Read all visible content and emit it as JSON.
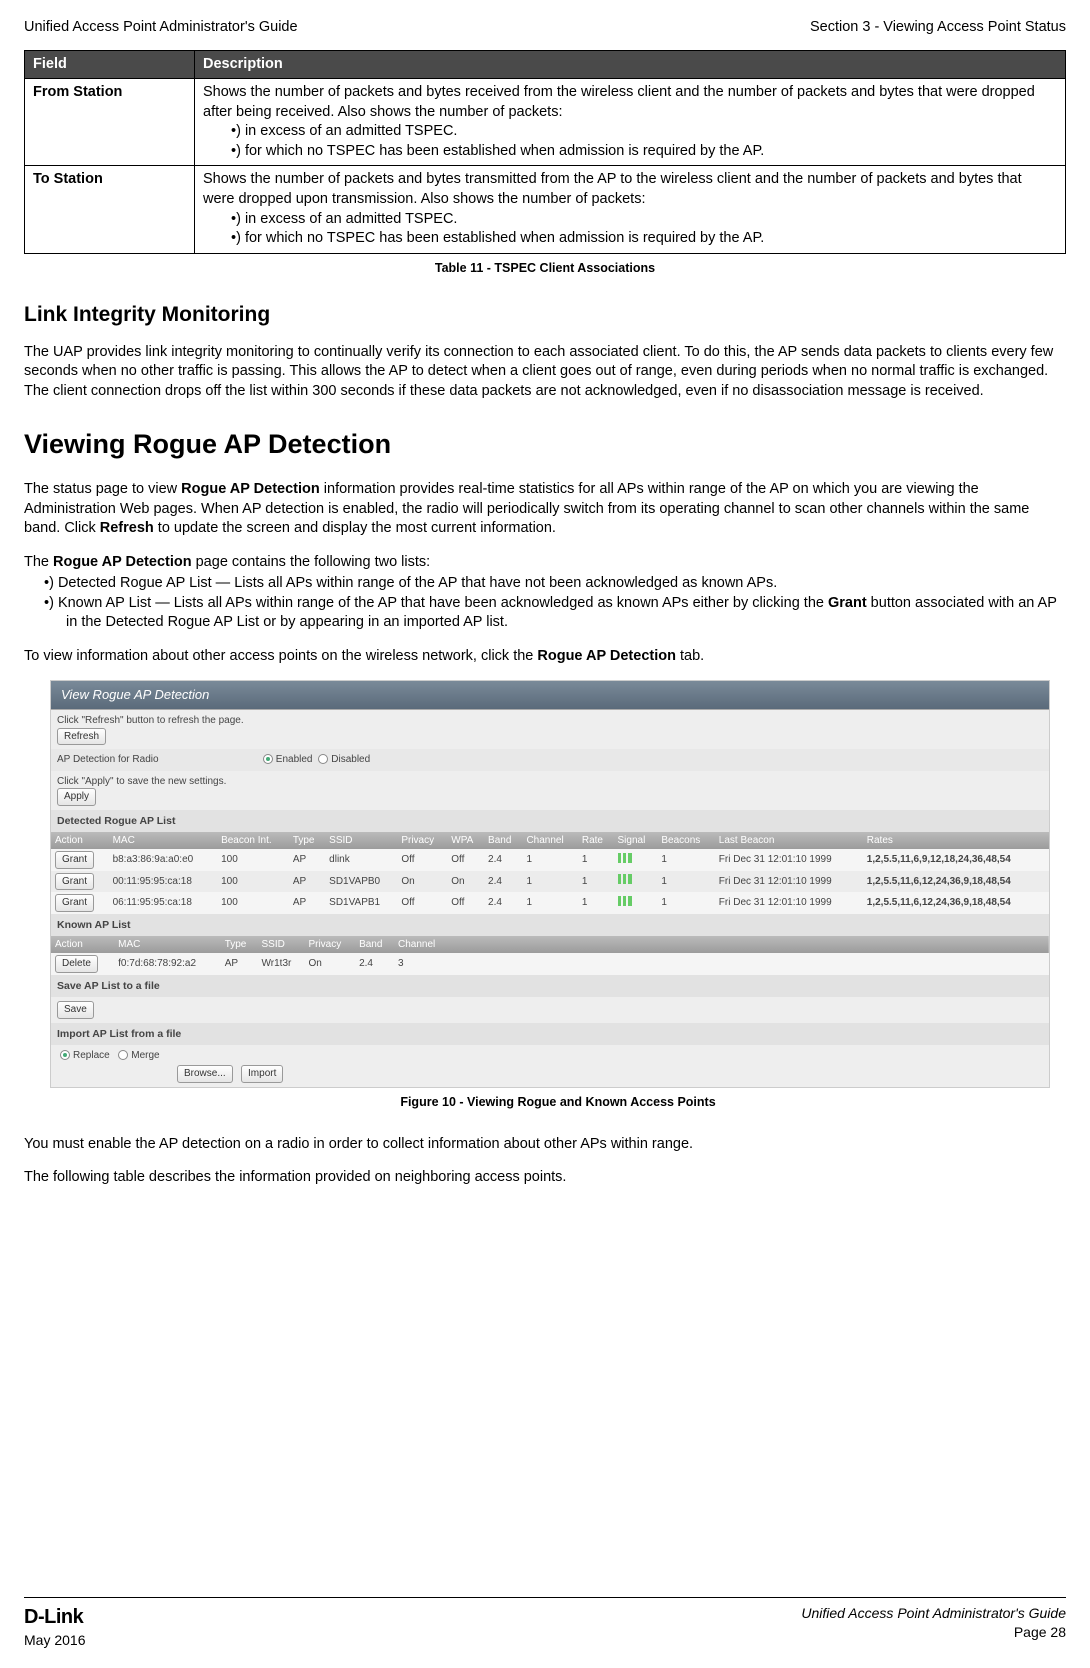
{
  "header": {
    "left": "Unified Access Point Administrator's Guide",
    "right": "Section 3 - Viewing Access Point Status"
  },
  "table11": {
    "col1": "Field",
    "col2": "Description",
    "rows": [
      {
        "field": "From Station",
        "desc_lead": "Shows the number of packets and bytes received from the wireless client and the number of packets and bytes that were dropped after being received. Also shows the number of packets:",
        "b1": "in excess of an admitted TSPEC.",
        "b2": "for which no TSPEC has been established when admission is required by the AP."
      },
      {
        "field": "To Station",
        "desc_lead": "Shows the number of packets and bytes transmitted from the AP to the wireless client and the number of packets and bytes that were dropped upon transmission. Also shows the number of packets:",
        "b1": "in excess of an admitted TSPEC.",
        "b2": "for which no TSPEC has been established when admission is required by the AP."
      }
    ],
    "caption": "Table 11 - TSPEC Client Associations"
  },
  "h2_link": "Link Integrity Monitoring",
  "p_link": "The UAP provides link integrity monitoring to continually verify its connection to each associated client. To do this, the AP sends data packets to clients every few seconds when no other traffic is passing. This allows the AP to detect when a client goes out of range, even during periods when no normal traffic is exchanged. The client connection drops off the list within 300 seconds if these data packets are not acknowledged, even if no disassociation message is received.",
  "h1_rogue": "Viewing Rogue AP Detection",
  "p_rogue1_a": "The status page to view ",
  "p_rogue1_b": "Rogue AP Detection",
  "p_rogue1_c": " information provides real-time statistics for all APs within range of the AP on which you are viewing the Administration Web pages. When AP detection is enabled, the radio will periodically switch from its operating channel to scan other channels within the same band. Click ",
  "p_rogue1_d": "Refresh",
  "p_rogue1_e": " to update the screen and display the most current information.",
  "p_rogue2_a": "The ",
  "p_rogue2_b": "Rogue AP Detection",
  "p_rogue2_c": " page contains the following two lists:",
  "li1": "Detected Rogue AP List — Lists all APs within range of the AP that have not been acknowledged as known APs.",
  "li2_a": "Known AP List — Lists all APs within range of the AP that have been acknowledged as known APs either by clicking the ",
  "li2_b": "Grant",
  "li2_c": " button associated with an AP in the Detected Rogue AP List or by appearing in an imported AP list.",
  "p_rogue3_a": "To view information about other access points on the wireless network, click the ",
  "p_rogue3_b": "Rogue AP Detection",
  "p_rogue3_c": " tab.",
  "figure": {
    "title": "View Rogue AP Detection",
    "refresh_hint": "Click \"Refresh\" button to refresh the page.",
    "refresh_btn": "Refresh",
    "radio_label": "AP Detection for Radio",
    "enabled": "Enabled",
    "disabled": "Disabled",
    "apply_hint": "Click \"Apply\" to save the new settings.",
    "apply_btn": "Apply",
    "detected_title": "Detected Rogue AP List",
    "hdr": {
      "action": "Action",
      "mac": "MAC",
      "beacon": "Beacon Int.",
      "type": "Type",
      "ssid": "SSID",
      "privacy": "Privacy",
      "wpa": "WPA",
      "band": "Band",
      "channel": "Channel",
      "rate": "Rate",
      "signal": "Signal",
      "beacons": "Beacons",
      "last": "Last Beacon",
      "rates": "Rates"
    },
    "detected_rows": [
      {
        "btn": "Grant",
        "mac": "b8:a3:86:9a:a0:e0",
        "bi": "100",
        "type": "AP",
        "ssid": "dlink",
        "priv": "Off",
        "wpa": "Off",
        "band": "2.4",
        "ch": "1",
        "rate": "1",
        "beacons": "1",
        "last": "Fri Dec 31 12:01:10 1999",
        "rates": "1,2,5.5,11,6,9,12,18,24,36,48,54"
      },
      {
        "btn": "Grant",
        "mac": "00:11:95:95:ca:18",
        "bi": "100",
        "type": "AP",
        "ssid": "SD1VAPB0",
        "priv": "On",
        "wpa": "On",
        "band": "2.4",
        "ch": "1",
        "rate": "1",
        "beacons": "1",
        "last": "Fri Dec 31 12:01:10 1999",
        "rates": "1,2,5.5,11,6,12,24,36,9,18,48,54"
      },
      {
        "btn": "Grant",
        "mac": "06:11:95:95:ca:18",
        "bi": "100",
        "type": "AP",
        "ssid": "SD1VAPB1",
        "priv": "Off",
        "wpa": "Off",
        "band": "2.4",
        "ch": "1",
        "rate": "1",
        "beacons": "1",
        "last": "Fri Dec 31 12:01:10 1999",
        "rates": "1,2,5.5,11,6,12,24,36,9,18,48,54"
      }
    ],
    "known_title": "Known AP List",
    "known_hdr": {
      "action": "Action",
      "mac": "MAC",
      "type": "Type",
      "ssid": "SSID",
      "privacy": "Privacy",
      "band": "Band",
      "channel": "Channel"
    },
    "known_rows": [
      {
        "btn": "Delete",
        "mac": "f0:7d:68:78:92:a2",
        "type": "AP",
        "ssid": "Wr1t3r",
        "priv": "On",
        "band": "2.4",
        "ch": "3"
      }
    ],
    "save_title": "Save AP List to a file",
    "save_btn": "Save",
    "import_title": "Import AP List from a file",
    "replace": "Replace",
    "merge": "Merge",
    "browse_btn": "Browse...",
    "import_btn": "Import",
    "caption": "Figure 10 - Viewing Rogue and Known Access Points"
  },
  "p_after1": "You must enable the AP detection on a radio in order to collect information about other APs within range.",
  "p_after2": "The following table describes the information provided on neighboring access points.",
  "footer": {
    "logo": "D-Link",
    "date": "May 2016",
    "right1": "Unified Access Point Administrator's Guide",
    "right2": "Page 28"
  }
}
